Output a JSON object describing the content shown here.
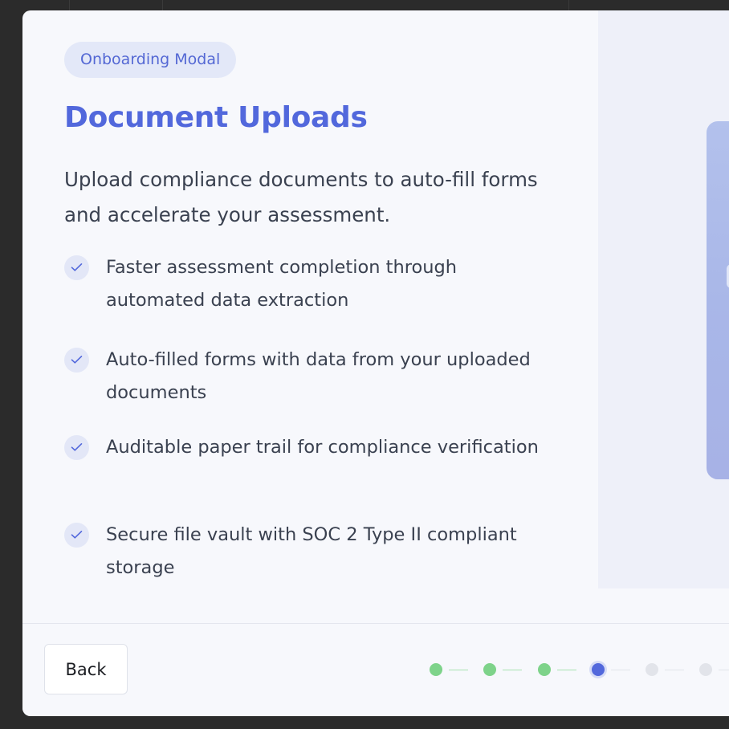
{
  "modal": {
    "badge": "Onboarding Modal",
    "title": "Document Uploads",
    "subtitle": "Upload compliance documents to auto-fill forms and accelerate your assessment.",
    "benefits": [
      {
        "text": "Faster assessment completion through automated data extraction",
        "icon": "check-icon"
      },
      {
        "text": "Auto-filled forms with data from your uploaded documents",
        "icon": "check-icon"
      },
      {
        "text": "Auditable paper trail for compliance verification",
        "icon": "check-icon"
      },
      {
        "text": "Secure file vault with SOC 2 Type II compliant storage",
        "icon": "check-icon"
      }
    ]
  },
  "footer": {
    "back_label": "Back",
    "steps": [
      {
        "state": "done"
      },
      {
        "state": "done"
      },
      {
        "state": "done"
      },
      {
        "state": "current"
      },
      {
        "state": "todo"
      },
      {
        "state": "todo"
      }
    ]
  },
  "colors": {
    "accent": "#5268dc",
    "badge_bg": "#e3e8f8",
    "step_done": "#7ed38a",
    "step_todo": "#e2e4ea",
    "text": "#3a4150",
    "backdrop": "#2b2b2b"
  }
}
